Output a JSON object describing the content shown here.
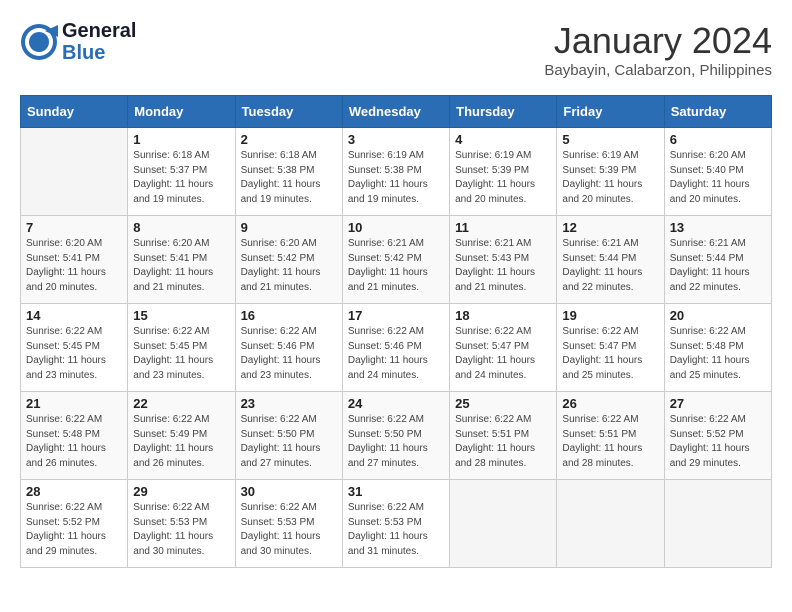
{
  "header": {
    "logo_general": "General",
    "logo_blue": "Blue",
    "month_title": "January 2024",
    "location": "Baybayin, Calabarzon, Philippines"
  },
  "days_of_week": [
    "Sunday",
    "Monday",
    "Tuesday",
    "Wednesday",
    "Thursday",
    "Friday",
    "Saturday"
  ],
  "weeks": [
    [
      {
        "day": "",
        "info": ""
      },
      {
        "day": "1",
        "info": "Sunrise: 6:18 AM\nSunset: 5:37 PM\nDaylight: 11 hours\nand 19 minutes."
      },
      {
        "day": "2",
        "info": "Sunrise: 6:18 AM\nSunset: 5:38 PM\nDaylight: 11 hours\nand 19 minutes."
      },
      {
        "day": "3",
        "info": "Sunrise: 6:19 AM\nSunset: 5:38 PM\nDaylight: 11 hours\nand 19 minutes."
      },
      {
        "day": "4",
        "info": "Sunrise: 6:19 AM\nSunset: 5:39 PM\nDaylight: 11 hours\nand 20 minutes."
      },
      {
        "day": "5",
        "info": "Sunrise: 6:19 AM\nSunset: 5:39 PM\nDaylight: 11 hours\nand 20 minutes."
      },
      {
        "day": "6",
        "info": "Sunrise: 6:20 AM\nSunset: 5:40 PM\nDaylight: 11 hours\nand 20 minutes."
      }
    ],
    [
      {
        "day": "7",
        "info": "Sunrise: 6:20 AM\nSunset: 5:41 PM\nDaylight: 11 hours\nand 20 minutes."
      },
      {
        "day": "8",
        "info": "Sunrise: 6:20 AM\nSunset: 5:41 PM\nDaylight: 11 hours\nand 21 minutes."
      },
      {
        "day": "9",
        "info": "Sunrise: 6:20 AM\nSunset: 5:42 PM\nDaylight: 11 hours\nand 21 minutes."
      },
      {
        "day": "10",
        "info": "Sunrise: 6:21 AM\nSunset: 5:42 PM\nDaylight: 11 hours\nand 21 minutes."
      },
      {
        "day": "11",
        "info": "Sunrise: 6:21 AM\nSunset: 5:43 PM\nDaylight: 11 hours\nand 21 minutes."
      },
      {
        "day": "12",
        "info": "Sunrise: 6:21 AM\nSunset: 5:44 PM\nDaylight: 11 hours\nand 22 minutes."
      },
      {
        "day": "13",
        "info": "Sunrise: 6:21 AM\nSunset: 5:44 PM\nDaylight: 11 hours\nand 22 minutes."
      }
    ],
    [
      {
        "day": "14",
        "info": "Sunrise: 6:22 AM\nSunset: 5:45 PM\nDaylight: 11 hours\nand 23 minutes."
      },
      {
        "day": "15",
        "info": "Sunrise: 6:22 AM\nSunset: 5:45 PM\nDaylight: 11 hours\nand 23 minutes."
      },
      {
        "day": "16",
        "info": "Sunrise: 6:22 AM\nSunset: 5:46 PM\nDaylight: 11 hours\nand 23 minutes."
      },
      {
        "day": "17",
        "info": "Sunrise: 6:22 AM\nSunset: 5:46 PM\nDaylight: 11 hours\nand 24 minutes."
      },
      {
        "day": "18",
        "info": "Sunrise: 6:22 AM\nSunset: 5:47 PM\nDaylight: 11 hours\nand 24 minutes."
      },
      {
        "day": "19",
        "info": "Sunrise: 6:22 AM\nSunset: 5:47 PM\nDaylight: 11 hours\nand 25 minutes."
      },
      {
        "day": "20",
        "info": "Sunrise: 6:22 AM\nSunset: 5:48 PM\nDaylight: 11 hours\nand 25 minutes."
      }
    ],
    [
      {
        "day": "21",
        "info": "Sunrise: 6:22 AM\nSunset: 5:48 PM\nDaylight: 11 hours\nand 26 minutes."
      },
      {
        "day": "22",
        "info": "Sunrise: 6:22 AM\nSunset: 5:49 PM\nDaylight: 11 hours\nand 26 minutes."
      },
      {
        "day": "23",
        "info": "Sunrise: 6:22 AM\nSunset: 5:50 PM\nDaylight: 11 hours\nand 27 minutes."
      },
      {
        "day": "24",
        "info": "Sunrise: 6:22 AM\nSunset: 5:50 PM\nDaylight: 11 hours\nand 27 minutes."
      },
      {
        "day": "25",
        "info": "Sunrise: 6:22 AM\nSunset: 5:51 PM\nDaylight: 11 hours\nand 28 minutes."
      },
      {
        "day": "26",
        "info": "Sunrise: 6:22 AM\nSunset: 5:51 PM\nDaylight: 11 hours\nand 28 minutes."
      },
      {
        "day": "27",
        "info": "Sunrise: 6:22 AM\nSunset: 5:52 PM\nDaylight: 11 hours\nand 29 minutes."
      }
    ],
    [
      {
        "day": "28",
        "info": "Sunrise: 6:22 AM\nSunset: 5:52 PM\nDaylight: 11 hours\nand 29 minutes."
      },
      {
        "day": "29",
        "info": "Sunrise: 6:22 AM\nSunset: 5:53 PM\nDaylight: 11 hours\nand 30 minutes."
      },
      {
        "day": "30",
        "info": "Sunrise: 6:22 AM\nSunset: 5:53 PM\nDaylight: 11 hours\nand 30 minutes."
      },
      {
        "day": "31",
        "info": "Sunrise: 6:22 AM\nSunset: 5:53 PM\nDaylight: 11 hours\nand 31 minutes."
      },
      {
        "day": "",
        "info": ""
      },
      {
        "day": "",
        "info": ""
      },
      {
        "day": "",
        "info": ""
      }
    ]
  ]
}
